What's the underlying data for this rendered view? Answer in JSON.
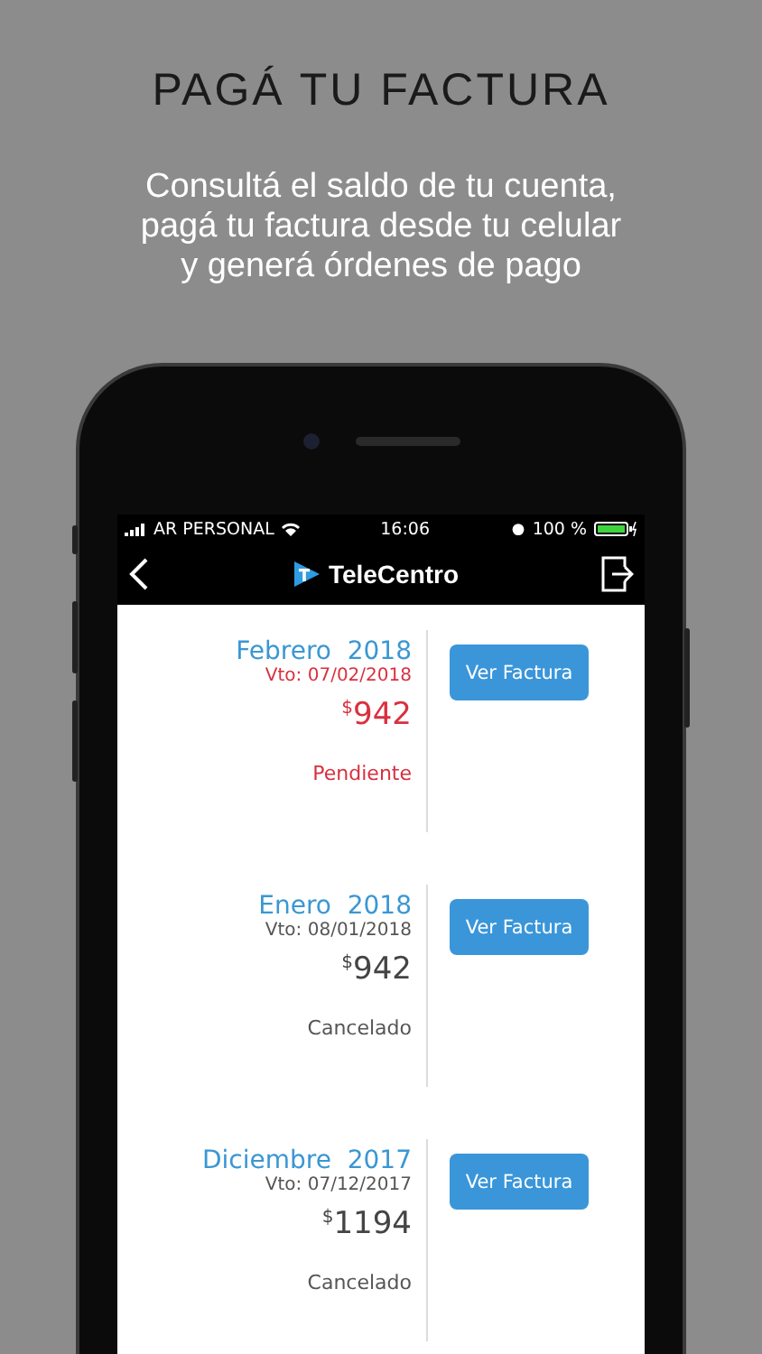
{
  "headline": "PAGÁ TU FACTURA",
  "subtitle_lines": [
    "Consultá el saldo de tu cuenta,",
    "pagá tu factura desde tu celular",
    "y generá órdenes de pago"
  ],
  "status_bar": {
    "carrier": "AR PERSONAL",
    "time": "16:06",
    "battery": "100 %"
  },
  "nav_bar": {
    "title": "TeleCentro"
  },
  "invoices": [
    {
      "month": "Febrero",
      "year": "2018",
      "due": "Vto: 07/02/2018",
      "currency": "$",
      "amount": "942",
      "status": "Pendiente",
      "kind": "pending",
      "button": "Ver Factura"
    },
    {
      "month": "Enero",
      "year": "2018",
      "due": "Vto: 08/01/2018",
      "currency": "$",
      "amount": "942",
      "status": "Cancelado",
      "kind": "paid",
      "button": "Ver Factura"
    },
    {
      "month": "Diciembre",
      "year": "2017",
      "due": "Vto: 07/12/2017",
      "currency": "$",
      "amount": "1194",
      "status": "Cancelado",
      "kind": "paid",
      "button": "Ver Factura"
    }
  ]
}
